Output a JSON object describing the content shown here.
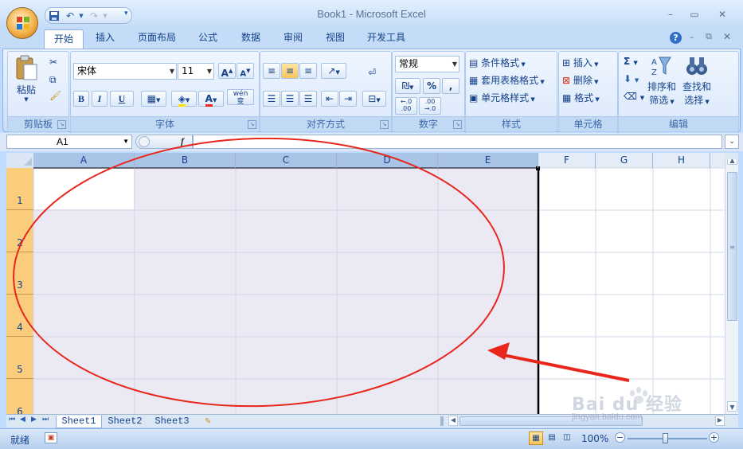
{
  "window": {
    "title": "Book1 - Microsoft Excel",
    "minimize": "▭",
    "maximize": "□",
    "close": "✕"
  },
  "tabs": [
    "开始",
    "插入",
    "页面布局",
    "公式",
    "数据",
    "审阅",
    "视图",
    "开发工具"
  ],
  "ribbon": {
    "clipboard": {
      "label": "剪贴板",
      "paste": "粘贴"
    },
    "font": {
      "label": "字体",
      "font_name": "宋体",
      "font_size": "11",
      "bold": "B",
      "italic": "I",
      "underline": "U",
      "phonetic": "wén"
    },
    "alignment": {
      "label": "对齐方式"
    },
    "number": {
      "label": "数字",
      "format": "常规",
      "percent": "%",
      "comma": ",",
      "inc_decimal": ".00",
      "dec_decimal": ".00"
    },
    "styles": {
      "label": "样式",
      "conditional": "条件格式",
      "table": "套用表格格式",
      "cell_styles": "单元格样式"
    },
    "cells": {
      "label": "单元格",
      "insert": "插入",
      "delete": "删除",
      "format": "格式"
    },
    "editing": {
      "label": "编辑",
      "sort_line1": "排序和",
      "sort_line2": "筛选",
      "find_line1": "查找和",
      "find_line2": "选择"
    }
  },
  "formula_bar": {
    "name_box": "A1",
    "fx": "f"
  },
  "grid": {
    "columns": [
      "A",
      "B",
      "C",
      "D",
      "E",
      "F",
      "G",
      "H"
    ],
    "rows": [
      "1",
      "2",
      "3",
      "4",
      "5",
      "6"
    ]
  },
  "sheets": [
    "Sheet1",
    "Sheet2",
    "Sheet3"
  ],
  "status": {
    "ready": "就绪",
    "zoom": "100%"
  },
  "watermark": {
    "brand": "Bai du 经验",
    "url": "jingyan.baidu.com"
  },
  "colors": {
    "annotation_red": "#e8261c",
    "selection_fill": "#eae9f4",
    "row_header_selected": "#f9cd7c"
  }
}
